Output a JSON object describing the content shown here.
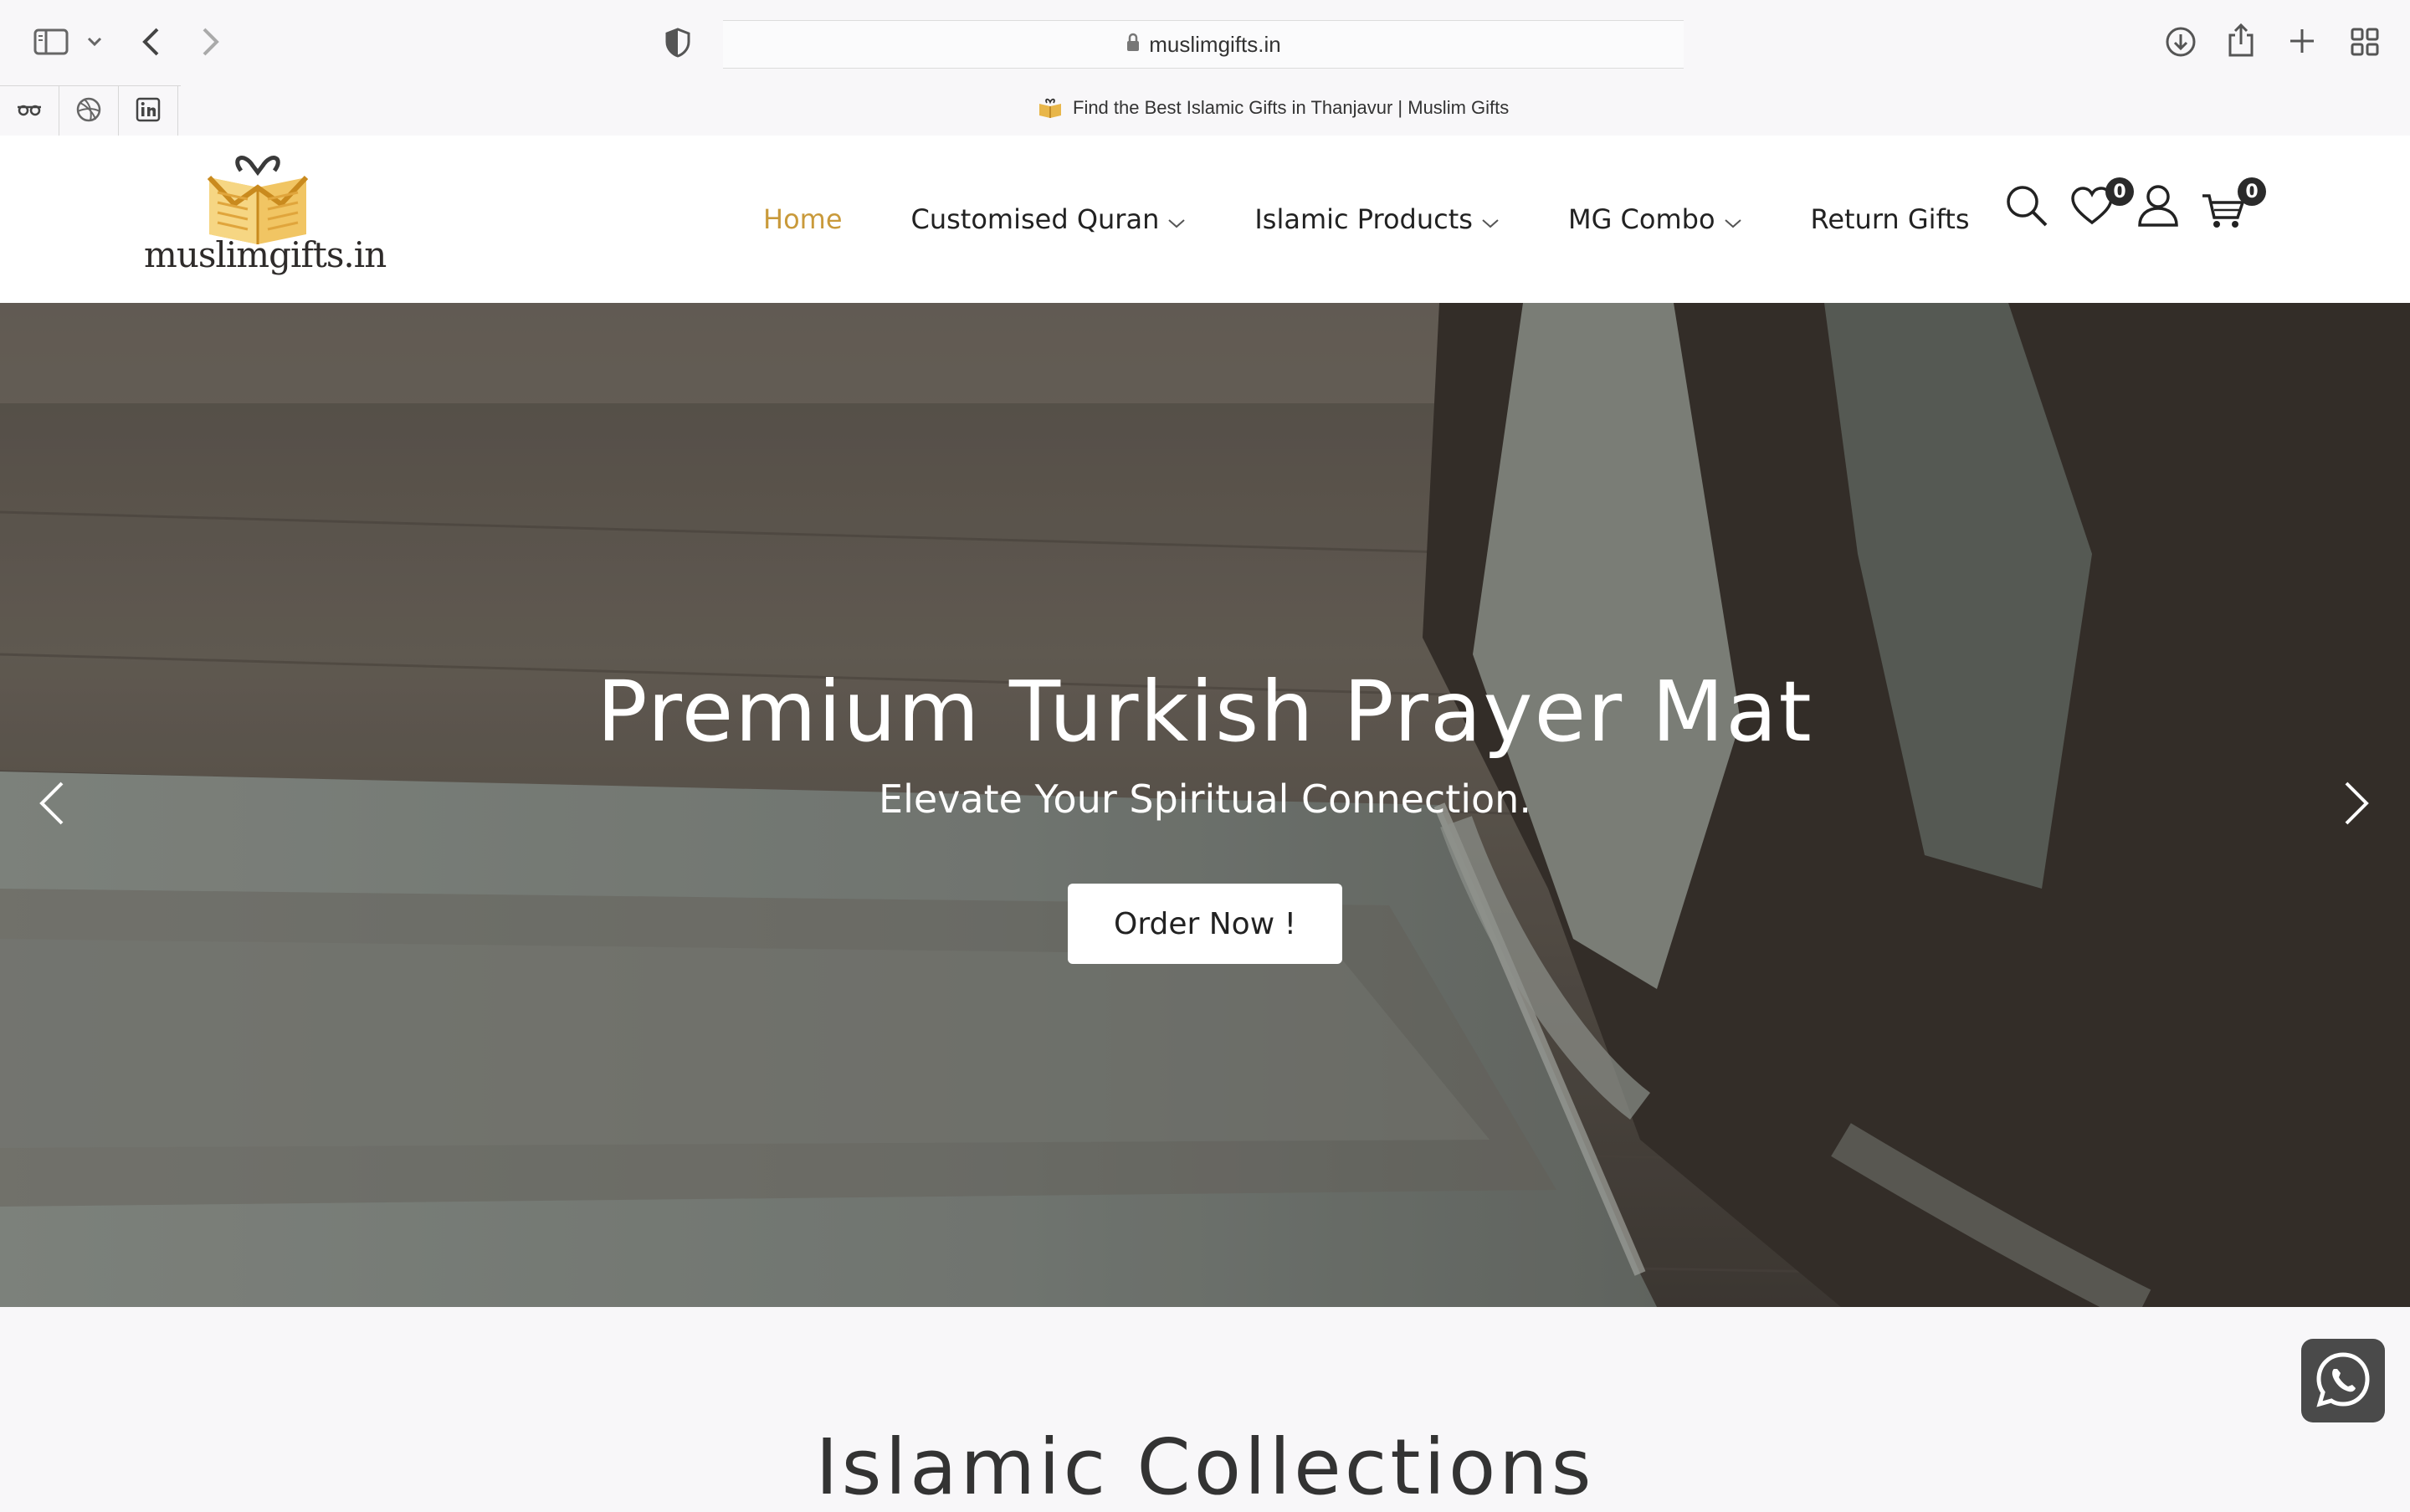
{
  "browser": {
    "url": "muslimgifts.in",
    "tab_title": "Find the Best Islamic Gifts in Thanjavur | Muslim Gifts",
    "icons": [
      "sidebar-icon",
      "chevron-down-icon",
      "back-icon",
      "forward-icon",
      "shield-icon",
      "lock-icon",
      "close-icon",
      "download-icon",
      "share-icon",
      "plus-icon",
      "tab-overview-icon"
    ],
    "pinned_tabs": [
      "glasses-icon",
      "dribbble-icon",
      "linkedin-icon"
    ]
  },
  "header": {
    "logo_text": "muslimgifts.in",
    "nav": [
      {
        "label": "Home",
        "active": true,
        "dropdown": false
      },
      {
        "label": "Customised Quran",
        "active": false,
        "dropdown": true
      },
      {
        "label": "Islamic Products",
        "active": false,
        "dropdown": true
      },
      {
        "label": "MG Combo",
        "active": false,
        "dropdown": true
      },
      {
        "label": "Return Gifts",
        "active": false,
        "dropdown": false
      }
    ],
    "wishlist_count": "0",
    "cart_count": "0",
    "accent_color": "#c99a3b"
  },
  "hero": {
    "title": "Premium Turkish Prayer Mat",
    "subtitle": "Elevate Your Spiritual Connection.",
    "cta": "Order Now !"
  },
  "section": {
    "title": "Islamic Collections"
  }
}
